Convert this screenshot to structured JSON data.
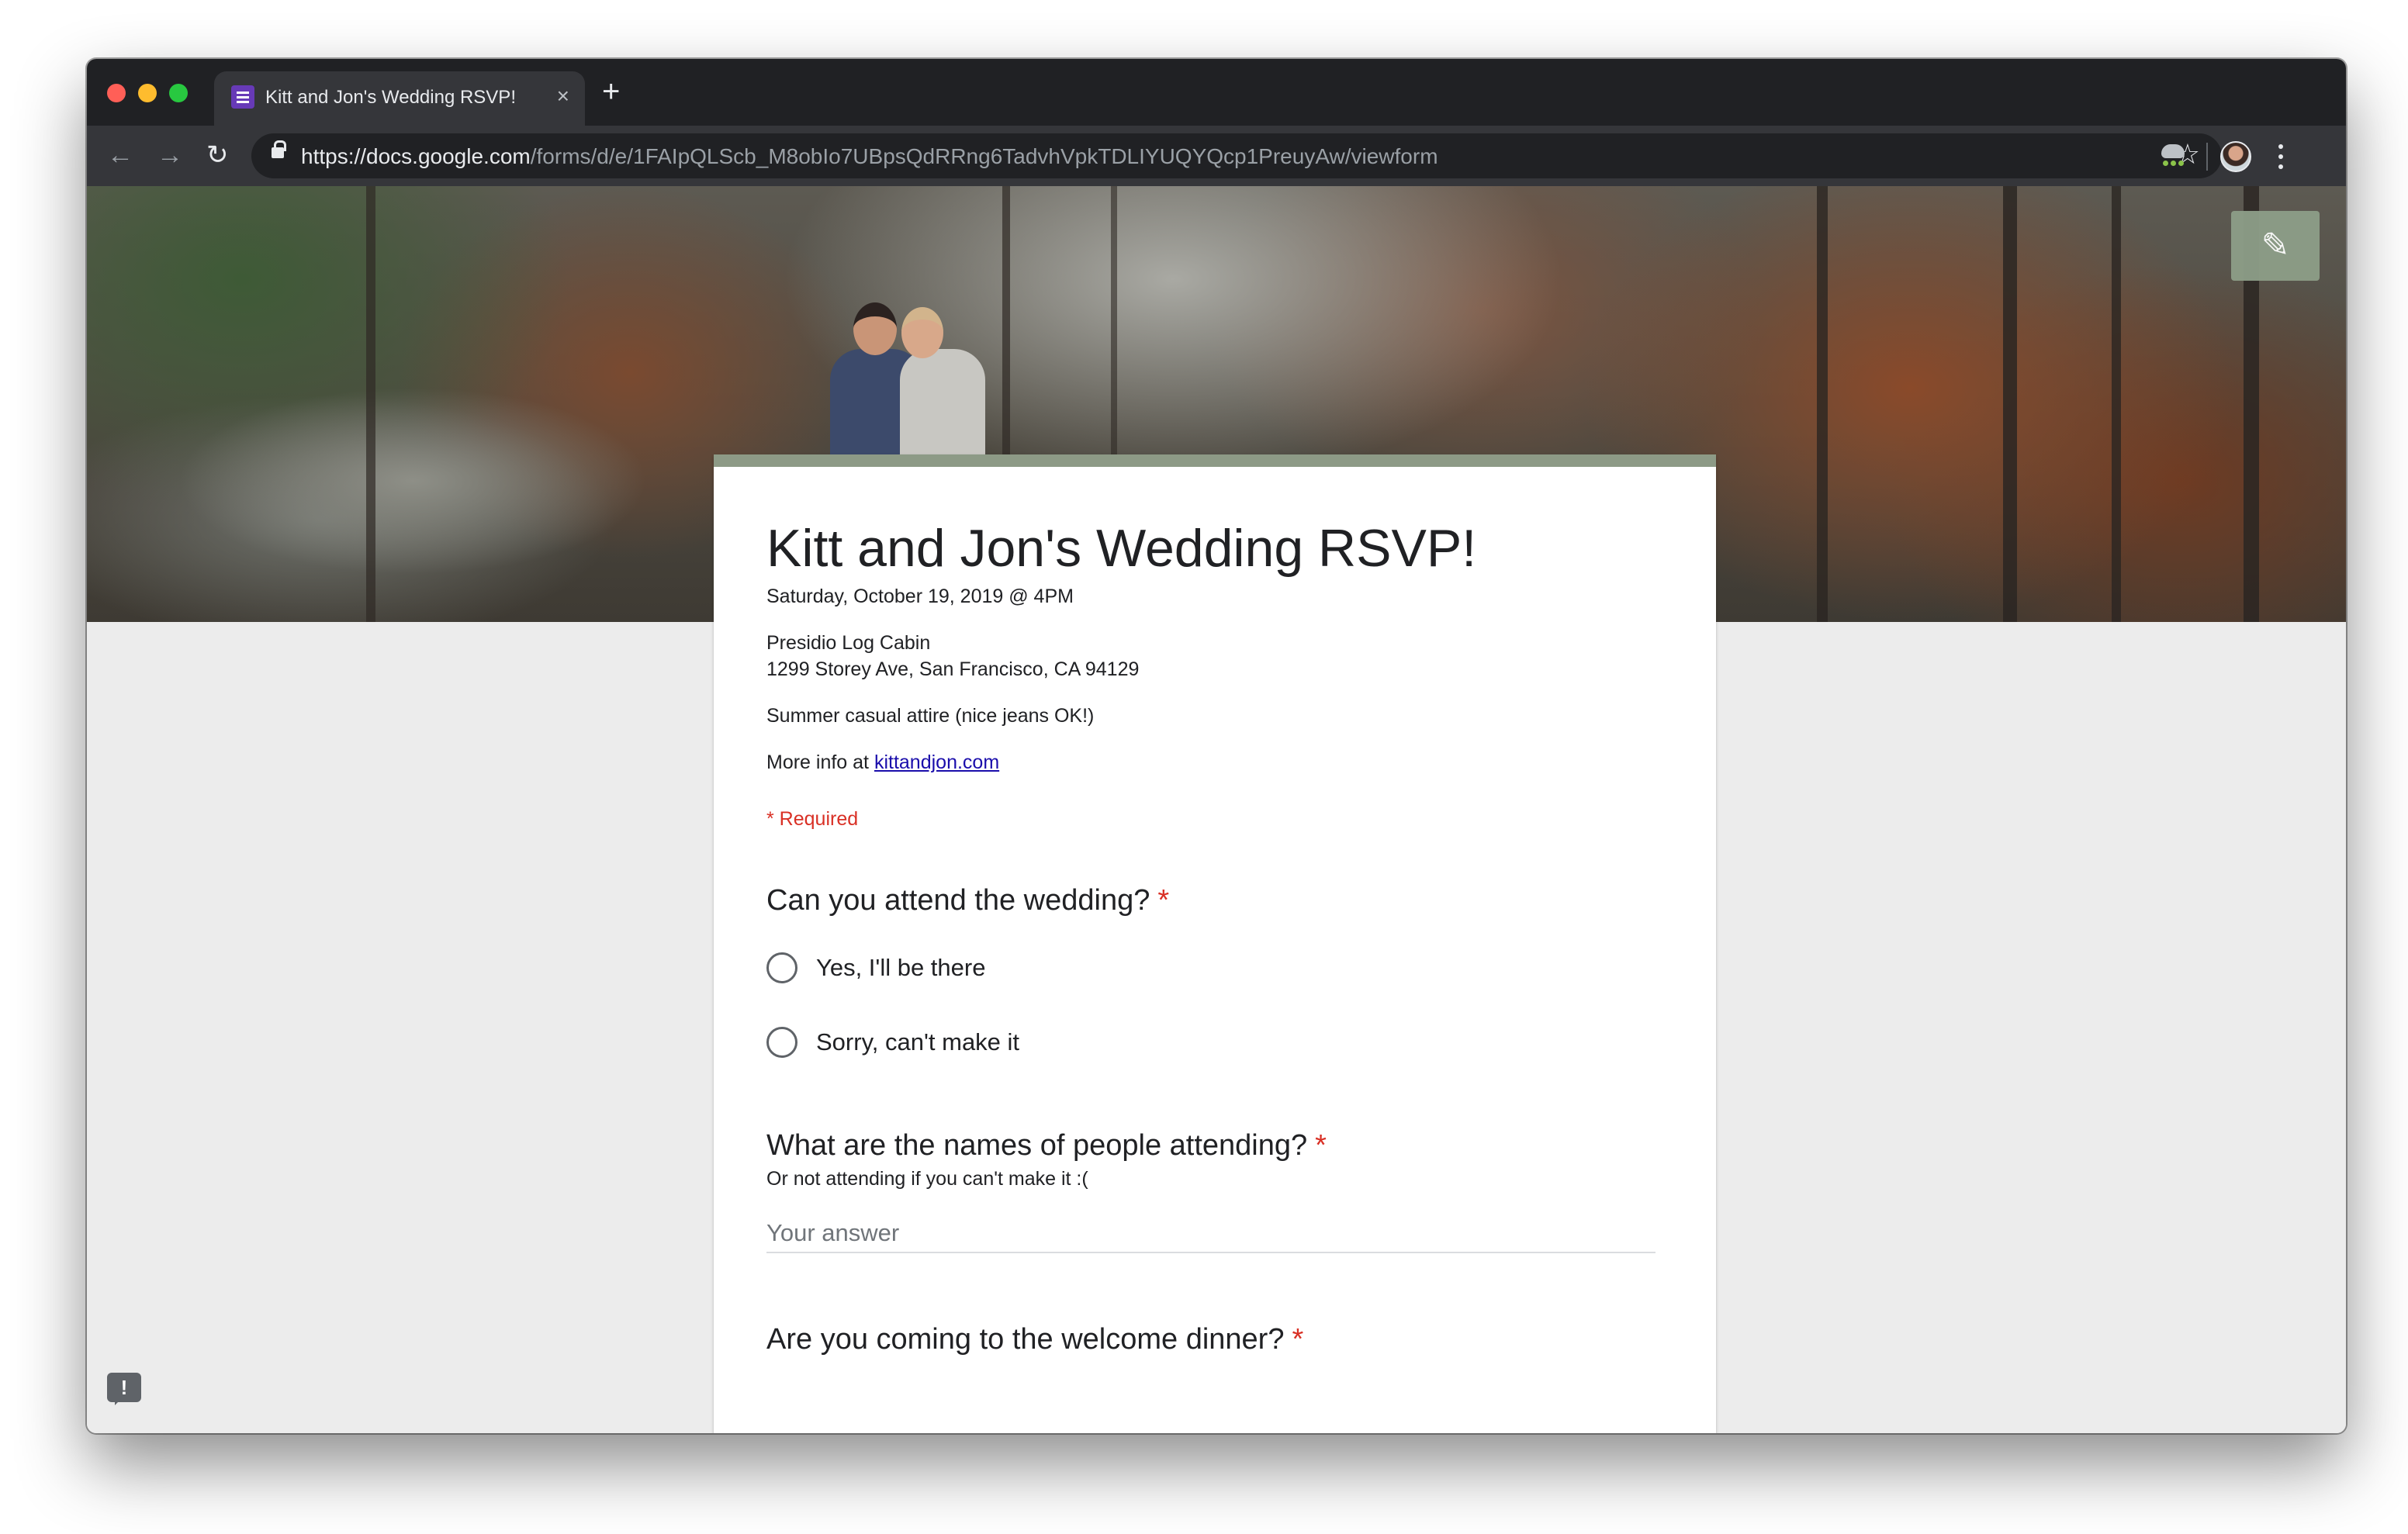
{
  "browser": {
    "tab_title": "Kitt and Jon's Wedding RSVP!",
    "tab_close": "×",
    "new_tab": "+",
    "url_host": "https://docs.google.com",
    "url_path": "/forms/d/e/1FAIpQLScb_M8obIo7UBpsQdRRng6TadvhVpkTDLIYUQYQcp1PreuyAw/viewform",
    "icons": {
      "back": "arrow-left-icon",
      "forward": "arrow-right-icon",
      "reload": "reload-icon",
      "bookmark": "star-icon",
      "menu": "kebab-menu-icon"
    }
  },
  "form": {
    "title": "Kitt and Jon's Wedding RSVP!",
    "description": {
      "date": "Saturday, October 19, 2019 @ 4PM",
      "venue": "Presidio Log Cabin",
      "address": "1299 Storey Ave, San Francisco, CA 94129",
      "attire": "Summer casual attire (nice jeans OK!)",
      "more_info_prefix": "More info at ",
      "more_info_link": "kittandjon.com"
    },
    "required_note": "* Required",
    "questions": [
      {
        "label": "Can you attend the wedding?",
        "required_mark": "*",
        "options": [
          "Yes, I'll be there",
          "Sorry, can't make it"
        ]
      },
      {
        "label": "What are the names of people attending?",
        "required_mark": "*",
        "help": "Or not attending if you can't make it :(",
        "placeholder": "Your answer"
      },
      {
        "label": "Are you coming to the welcome dinner?",
        "required_mark": "*"
      }
    ],
    "edit_icon": "pencil-icon",
    "feedback_icon": "feedback-icon",
    "feedback_glyph": "!"
  },
  "colors": {
    "theme": "#8d9a86",
    "required": "#d93025",
    "link": "#1a0dab"
  }
}
